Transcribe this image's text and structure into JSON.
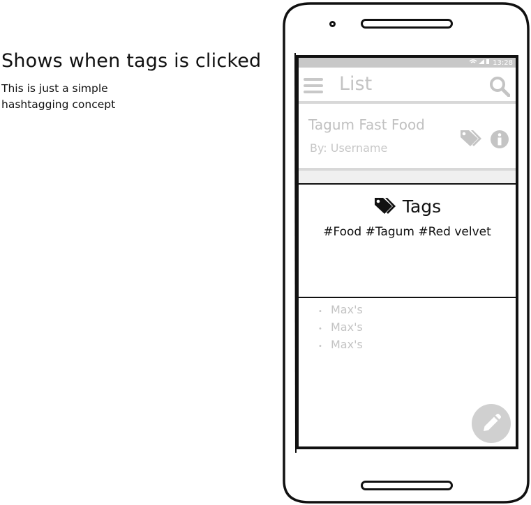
{
  "annotation": {
    "title": "Shows when tags is clicked",
    "body": "This is just a simple hashtagging concept"
  },
  "status_bar": {
    "icons": "wifi signal battery",
    "time": "13:28"
  },
  "appbar": {
    "title": "List"
  },
  "card": {
    "title": "Tagum Fast Food",
    "subtitle": "By: Username"
  },
  "tags_popup": {
    "title": "Tags",
    "tags": "#Food #Tagum #Red velvet"
  },
  "list": {
    "items": [
      "Max's",
      "Max's",
      "Max's"
    ]
  },
  "colors": {
    "muted": "#c4c4c4",
    "fab": "#d0d0d0",
    "outline": "#111111"
  }
}
